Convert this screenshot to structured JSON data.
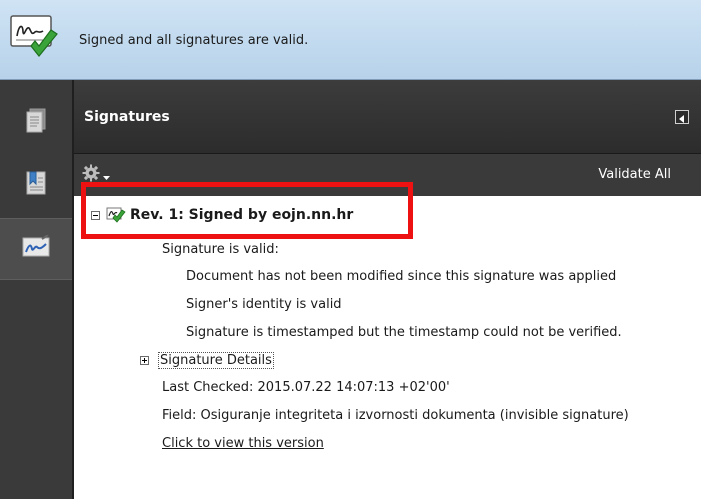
{
  "banner": {
    "message": "Signed and all signatures are valid.",
    "icon": "signature-valid-icon"
  },
  "navigation": {
    "items": [
      {
        "name": "pages",
        "icon": "pages-icon"
      },
      {
        "name": "bookmarks",
        "icon": "bookmarks-icon"
      },
      {
        "name": "signatures",
        "icon": "signature-pen-icon",
        "active": true
      }
    ]
  },
  "panel": {
    "title": "Signatures",
    "toolbar": {
      "options_icon": "gear-icon",
      "validate_all_label": "Validate All"
    }
  },
  "signature": {
    "title": "Rev. 1: Signed by eojn.nn.hr",
    "status": "Signature is valid:",
    "details": [
      "Document has not been modified since this signature was applied",
      "Signer's identity is valid",
      "Signature is timestamped but the timestamp could not be verified."
    ],
    "details_label": "Signature Details",
    "last_checked": "Last Checked: 2015.07.22 14:07:13 +02'00'",
    "field": "Field: Osiguranje integriteta i izvornosti dokumenta (invisible signature)",
    "view_version_link": "Click to view this version"
  },
  "colors": {
    "banner_bg": "#c3daef",
    "dark_panel": "#3a3a3a",
    "highlight": "#ee1111",
    "valid_check": "#3aa43a"
  }
}
